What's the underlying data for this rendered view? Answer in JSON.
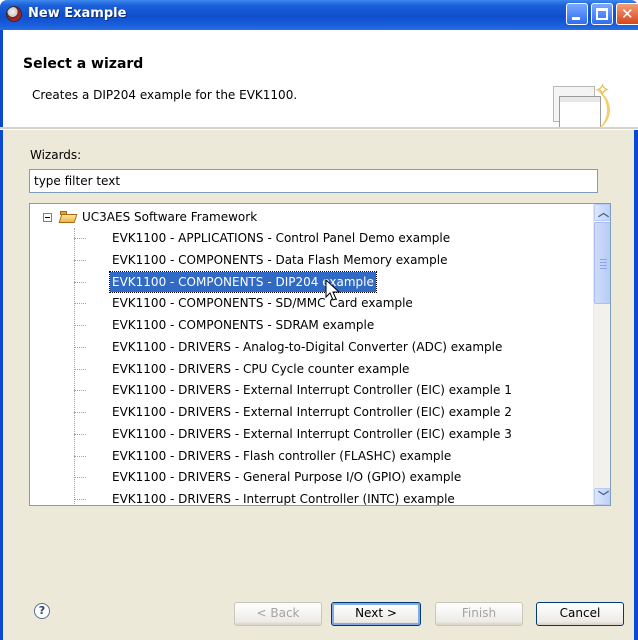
{
  "window": {
    "title": "New Example"
  },
  "header": {
    "title": "Select a wizard",
    "description": "Creates a DIP204 example for the EVK1100."
  },
  "wizards_label": "Wizards:",
  "filter": {
    "value": "type filter text"
  },
  "tree": {
    "root": "UC3AES Software Framework",
    "items": [
      "EVK1100 - APPLICATIONS - Control Panel Demo example",
      "EVK1100 - COMPONENTS - Data Flash Memory example",
      "EVK1100 - COMPONENTS - DIP204 example",
      "EVK1100 - COMPONENTS - SD/MMC Card example",
      "EVK1100 - COMPONENTS - SDRAM example",
      "EVK1100 - DRIVERS - Analog-to-Digital Converter (ADC) example",
      "EVK1100 - DRIVERS - CPU Cycle counter example",
      "EVK1100 - DRIVERS - External Interrupt Controller (EIC) example 1",
      "EVK1100 - DRIVERS - External Interrupt Controller (EIC) example 2",
      "EVK1100 - DRIVERS - External Interrupt Controller (EIC) example 3",
      "EVK1100 - DRIVERS - Flash controller (FLASHC) example",
      "EVK1100 - DRIVERS - General Purpose I/O (GPIO) example",
      "EVK1100 - DRIVERS - Interrupt Controller (INTC) example"
    ],
    "selected_index": 2
  },
  "buttons": {
    "help": "?",
    "back": "< Back",
    "next": "Next >",
    "finish": "Finish",
    "cancel": "Cancel"
  },
  "icons": {
    "app": "eclipse-app-icon",
    "wizard_banner": "new-wizard-icon",
    "root_folder": "folder-open-icon",
    "help": "help-icon"
  },
  "colors": {
    "titlebar": "#0f4fce",
    "selection": "#316ac5",
    "dialog_bg": "#ece9d8"
  }
}
